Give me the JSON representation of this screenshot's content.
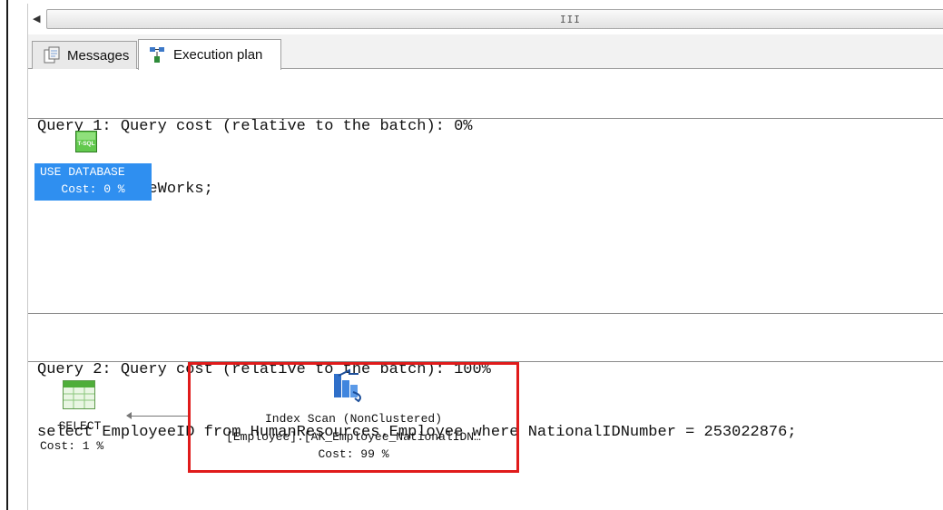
{
  "scrollbar": {
    "grip": "III"
  },
  "tabs": [
    {
      "label": "Messages",
      "icon": "messages-icon"
    },
    {
      "label": "Execution plan",
      "icon": "execution-plan-icon"
    }
  ],
  "query1": {
    "header": "Query 1: Query cost (relative to the batch): 0%",
    "sql": "use AdventureWorks;",
    "node": {
      "icon_text": "T-SQL",
      "name": "USE DATABASE",
      "cost": "Cost: 0 %"
    }
  },
  "query2": {
    "header": "Query 2: Query cost (relative to the batch): 100%",
    "sql": "select EmployeeID from HumanResources.Employee where NationalIDNumber = 253022876;",
    "select_node": {
      "name": "SELECT",
      "cost": "Cost: 1 %"
    },
    "scan_node": {
      "name": "Index Scan (NonClustered)",
      "object": "[Employee].[AK_Employee_NationalIDN…",
      "cost": "Cost: 99 %"
    }
  },
  "colors": {
    "selection": "#2f8ff0",
    "highlight": "#e01b1b",
    "tsql_icon": "#62c94e"
  }
}
